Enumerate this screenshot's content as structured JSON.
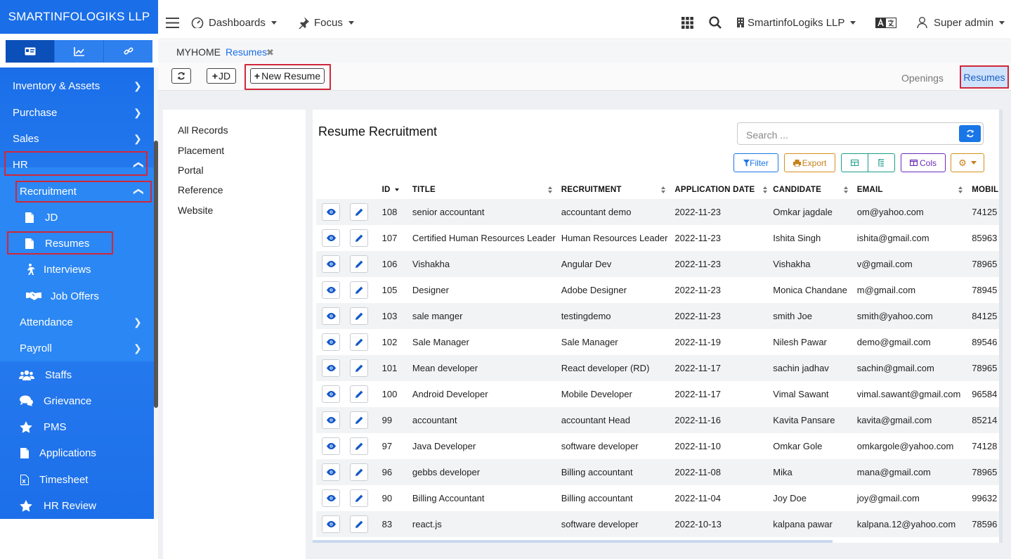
{
  "brand": "SMARTINFOLOGIKS LLP",
  "sidebar_menu": {
    "inventory": "Inventory & Assets",
    "purchase": "Purchase",
    "sales": "Sales",
    "hr": "HR",
    "recruitment": "Recruitment",
    "jd": "JD",
    "resumes": "Resumes",
    "interviews": "Interviews",
    "job_offers": "Job Offers",
    "attendance": "Attendance",
    "payroll": "Payroll",
    "staffs": "Staffs",
    "grievance": "Grievance",
    "pms": "PMS",
    "applications": "Applications",
    "timesheet": "Timesheet",
    "hr_review": "HR Review"
  },
  "topbar": {
    "dashboards": "Dashboards",
    "focus": "Focus",
    "company": "SmartinfoLogiks LLP",
    "user": "Super admin"
  },
  "breadcrumb": {
    "home": "MYHOME",
    "current": "Resumes"
  },
  "toolbar": {
    "jd_label": "JD",
    "new_resume_label": "New Resume",
    "openings_tab": "Openings",
    "resumes_tab": "Resumes"
  },
  "filters": [
    "All Records",
    "Placement",
    "Portal",
    "Reference",
    "Website"
  ],
  "card": {
    "title": "Resume Recruitment",
    "search_placeholder": "Search ...",
    "filter_label": "Filter",
    "export_label": "Export",
    "cols_label": "Cols"
  },
  "table": {
    "columns": [
      "ID",
      "TITLE",
      "RECRUITMENT",
      "APPLICATION DATE",
      "CANDIDATE",
      "EMAIL",
      "MOBIL"
    ],
    "rows": [
      [
        "108",
        "senior accountant",
        "accountant demo",
        "2022-11-23",
        "Omkar jagdale",
        "om@yahoo.com",
        "74125"
      ],
      [
        "107",
        "Certified Human Resources Leader",
        "Human Resources Leader",
        "2022-11-23",
        "Ishita Singh",
        "ishita@gmail.com",
        "85963"
      ],
      [
        "106",
        "Vishakha",
        "Angular Dev",
        "2022-11-23",
        "Vishakha",
        "v@gmail.com",
        "78965"
      ],
      [
        "105",
        "Designer",
        "Adobe Designer",
        "2022-11-23",
        "Monica Chandane",
        "m@gmail.com",
        "78945"
      ],
      [
        "103",
        "sale manger",
        "testingdemo",
        "2022-11-23",
        "smith Joe",
        "smith@yahoo.com",
        "84125"
      ],
      [
        "102",
        "Sale Manager",
        "Sale Manager",
        "2022-11-19",
        "Nilesh Pawar",
        "demo@gmail.com",
        "89546"
      ],
      [
        "101",
        "Mean developer",
        "React developer (RD)",
        "2022-11-17",
        "sachin jadhav",
        "sachin@gmail.com",
        "78965"
      ],
      [
        "100",
        "Android Developer",
        "Mobile Developer",
        "2022-11-17",
        "Vimal Sawant",
        "vimal.sawant@gmail.com",
        "96584"
      ],
      [
        "99",
        "accountant",
        "accountant Head",
        "2022-11-16",
        "Kavita Pansare",
        "kavita@gmail.com",
        "85214"
      ],
      [
        "97",
        "Java Developer",
        "software developer",
        "2022-11-10",
        "Omkar Gole",
        "omkargole@yahoo.com",
        "74128"
      ],
      [
        "96",
        "gebbs developer",
        "Billing accountant",
        "2022-11-08",
        "Mika",
        "mana@gmail.com",
        "78965"
      ],
      [
        "90",
        "Billing Accountant",
        "Billing accountant",
        "2022-11-04",
        "Joy Doe",
        "joy@gmail.com",
        "99632"
      ],
      [
        "83",
        "react.js",
        "software developer",
        "2022-10-13",
        "kalpana pawar",
        "kalpana.12@yahoo.com",
        "78596"
      ]
    ]
  },
  "colors": {
    "brand_blue": "#1a6ee8",
    "highlight_red": "#d0283a",
    "action_blue": "#1976e6"
  }
}
